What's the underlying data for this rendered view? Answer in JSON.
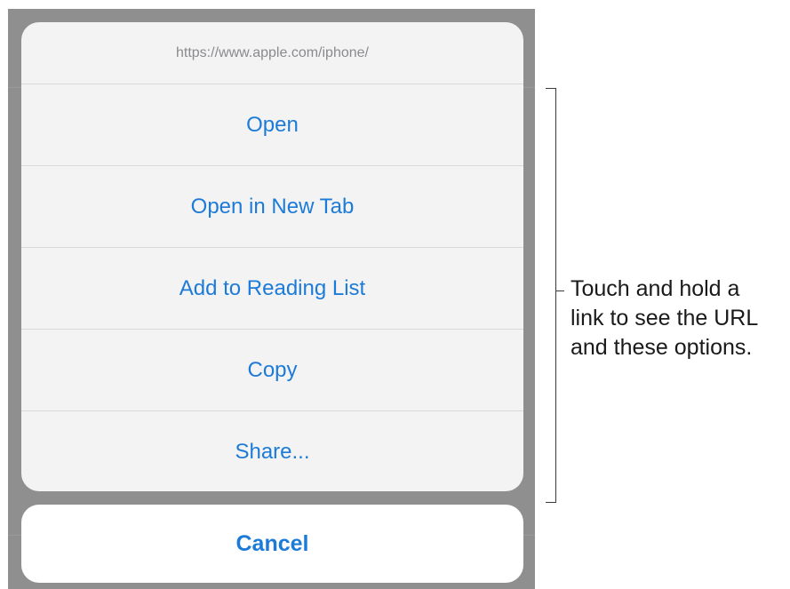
{
  "sheet": {
    "url": "https://www.apple.com/iphone/",
    "actions": [
      {
        "label": "Open"
      },
      {
        "label": "Open in New Tab"
      },
      {
        "label": "Add to Reading List"
      },
      {
        "label": "Copy"
      },
      {
        "label": "Share..."
      }
    ],
    "cancel_label": "Cancel"
  },
  "callout": {
    "lines": [
      "Touch and hold a",
      "link to see the URL",
      "and these options."
    ]
  },
  "colors": {
    "accent": "#1d7bd8",
    "backdrop": "#8f8f8f",
    "sheet_bg": "#f3f3f3"
  }
}
